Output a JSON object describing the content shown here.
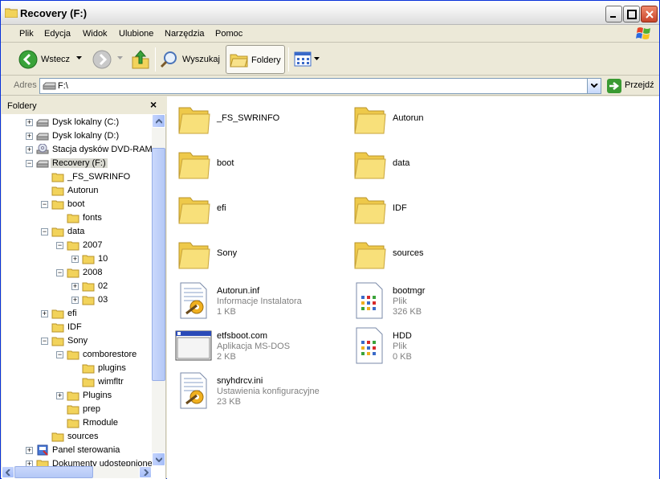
{
  "window": {
    "title": "Recovery (F:)"
  },
  "menu": [
    "Plik",
    "Edycja",
    "Widok",
    "Ulubione",
    "Narzędzia",
    "Pomoc"
  ],
  "toolbar": {
    "back": "Wstecz",
    "search": "Wyszukaj",
    "folders": "Foldery"
  },
  "address": {
    "label": "Adres",
    "value": "F:\\",
    "go": "Przejdź"
  },
  "folder_pane": {
    "title": "Foldery",
    "close": "×",
    "tree": [
      {
        "label": "Dysk lokalny (C:)",
        "icon": "drive-icon",
        "exp": "+"
      },
      {
        "label": "Dysk lokalny (D:)",
        "icon": "drive-icon",
        "exp": "+"
      },
      {
        "label": "Stacja dysków DVD-RAM",
        "icon": "dvd-icon",
        "exp": "+"
      },
      {
        "label": "Recovery (F:)",
        "icon": "drive-icon",
        "exp": "−",
        "selected": true
      },
      {
        "label": "_FS_SWRINFO",
        "icon": "folder-icon",
        "exp": ""
      },
      {
        "label": "Autorun",
        "icon": "folder-icon",
        "exp": ""
      },
      {
        "label": "boot",
        "icon": "folder-icon",
        "exp": "−"
      },
      {
        "label": "fonts",
        "icon": "folder-icon",
        "exp": ""
      },
      {
        "label": "data",
        "icon": "folder-icon",
        "exp": "−"
      },
      {
        "label": "2007",
        "icon": "folder-icon",
        "exp": "−"
      },
      {
        "label": "10",
        "icon": "folder-icon",
        "exp": "+"
      },
      {
        "label": "2008",
        "icon": "folder-icon",
        "exp": "−"
      },
      {
        "label": "02",
        "icon": "folder-icon",
        "exp": "+"
      },
      {
        "label": "03",
        "icon": "folder-icon",
        "exp": "+"
      },
      {
        "label": "efi",
        "icon": "folder-icon",
        "exp": "+"
      },
      {
        "label": "IDF",
        "icon": "folder-icon",
        "exp": ""
      },
      {
        "label": "Sony",
        "icon": "folder-icon",
        "exp": "−"
      },
      {
        "label": "comborestore",
        "icon": "folder-icon",
        "exp": "−"
      },
      {
        "label": "plugins",
        "icon": "folder-icon",
        "exp": ""
      },
      {
        "label": "wimfltr",
        "icon": "folder-icon",
        "exp": ""
      },
      {
        "label": "Plugins",
        "icon": "folder-icon",
        "exp": "+"
      },
      {
        "label": "prep",
        "icon": "folder-icon",
        "exp": ""
      },
      {
        "label": "Rmodule",
        "icon": "folder-icon",
        "exp": ""
      },
      {
        "label": "sources",
        "icon": "folder-icon",
        "exp": ""
      },
      {
        "label": "Panel sterowania",
        "icon": "control-panel-icon",
        "exp": "+"
      },
      {
        "label": "Dokumenty udostępnione",
        "icon": "folder-icon",
        "exp": "+"
      }
    ]
  },
  "files": [
    {
      "name": "_FS_SWRINFO",
      "type": "folder"
    },
    {
      "name": "Autorun",
      "type": "folder"
    },
    {
      "name": "boot",
      "type": "folder"
    },
    {
      "name": "data",
      "type": "folder"
    },
    {
      "name": "efi",
      "type": "folder"
    },
    {
      "name": "IDF",
      "type": "folder"
    },
    {
      "name": "Sony",
      "type": "folder"
    },
    {
      "name": "sources",
      "type": "folder"
    },
    {
      "name": "Autorun.inf",
      "type": "setup",
      "desc": "Informacje Instalatora",
      "size": "1 KB"
    },
    {
      "name": "bootmgr",
      "type": "generic",
      "desc": "Plik",
      "size": "326 KB"
    },
    {
      "name": "etfsboot.com",
      "type": "msdos",
      "desc": "Aplikacja MS-DOS",
      "size": "2 KB"
    },
    {
      "name": "HDD",
      "type": "generic",
      "desc": "Plik",
      "size": "0 KB"
    },
    {
      "name": "snyhdrcv.ini",
      "type": "setup",
      "desc": "Ustawienia konfiguracyjne",
      "size": "23 KB"
    }
  ]
}
